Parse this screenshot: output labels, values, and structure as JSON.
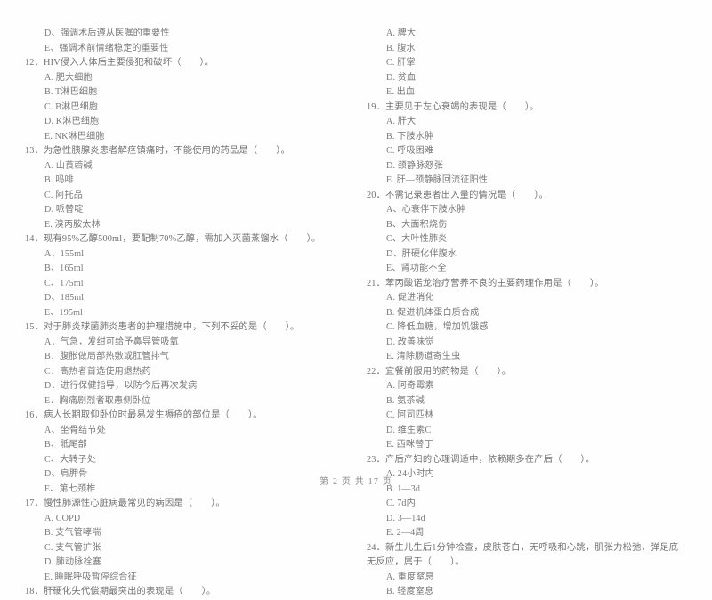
{
  "document": {
    "type": "scanned-exam-paper",
    "background_color": "#fefefe",
    "text_color": "#6e6e6e",
    "footer": "第 2 页 共 17 页"
  },
  "columns": [
    {
      "id": "left-column",
      "items": [
        {
          "kind": "option",
          "text": "D、强调术后遵从医嘱的重要性"
        },
        {
          "kind": "option",
          "text": "E、强调术前情绪稳定的重要性"
        },
        {
          "kind": "stem",
          "text": "12．HIV侵入人体后主要侵犯和破坏（　　）。"
        },
        {
          "kind": "option",
          "text": "A. 肥大细胞"
        },
        {
          "kind": "option",
          "text": "B. T淋巴细胞"
        },
        {
          "kind": "option",
          "text": "C. B淋巴细胞"
        },
        {
          "kind": "option",
          "text": "D. K淋巴细胞"
        },
        {
          "kind": "option",
          "text": "E. NK淋巴细胞"
        },
        {
          "kind": "stem",
          "text": "13．为急性胰腺炎患者解痉镇痛时，不能使用的药品是（　　）。"
        },
        {
          "kind": "option",
          "text": "A. 山莨菪碱"
        },
        {
          "kind": "option",
          "text": "B. 吗啡"
        },
        {
          "kind": "option",
          "text": "C. 阿托品"
        },
        {
          "kind": "option",
          "text": "D. 哌替啶"
        },
        {
          "kind": "option",
          "text": "E. 溴丙胺太林"
        },
        {
          "kind": "stem",
          "text": "14．现有95%乙醇500ml，要配制70%乙醇，需加入灭菌蒸馏水（　　）。"
        },
        {
          "kind": "option",
          "text": "A、155ml"
        },
        {
          "kind": "option",
          "text": "B、165ml"
        },
        {
          "kind": "option",
          "text": "C、175ml"
        },
        {
          "kind": "option",
          "text": "D、185ml"
        },
        {
          "kind": "option",
          "text": "E、195ml"
        },
        {
          "kind": "stem",
          "text": "15．对于肺炎球菌肺炎患者的护理措施中，下列不妥的是（　　）。"
        },
        {
          "kind": "option",
          "text": "A．气急，发绀可给予鼻导管吸氧"
        },
        {
          "kind": "option",
          "text": "B．腹胀做局部热敷或肛管排气"
        },
        {
          "kind": "option",
          "text": "C．高热者首选使用退热药"
        },
        {
          "kind": "option",
          "text": "D．进行保健指导，以防今后再次发病"
        },
        {
          "kind": "option",
          "text": "E．胸痛剧烈者取患侧卧位"
        },
        {
          "kind": "stem",
          "text": "16．病人长期取仰卧位时最易发生褥疮的部位是（　　）。"
        },
        {
          "kind": "option",
          "text": "A、坐骨结节处"
        },
        {
          "kind": "option",
          "text": "B、骶尾部"
        },
        {
          "kind": "option",
          "text": "C、大转子处"
        },
        {
          "kind": "option",
          "text": "D、肩胛骨"
        },
        {
          "kind": "option",
          "text": "E、第七颈椎"
        },
        {
          "kind": "stem",
          "text": "17．慢性肺源性心脏病最常见的病因是（　　）。"
        },
        {
          "kind": "option",
          "text": "A. COPD"
        },
        {
          "kind": "option",
          "text": "B. 支气管哮喘"
        },
        {
          "kind": "option",
          "text": "C. 支气管扩张"
        },
        {
          "kind": "option",
          "text": "D. 肺动脉栓塞"
        },
        {
          "kind": "option",
          "text": "E. 睡眠呼吸暂停综合征"
        },
        {
          "kind": "stem",
          "text": "18．肝硬化失代偿期最突出的表现是（　　）。"
        }
      ]
    },
    {
      "id": "right-column",
      "items": [
        {
          "kind": "option",
          "text": "A. 脾大"
        },
        {
          "kind": "option",
          "text": "B. 腹水"
        },
        {
          "kind": "option",
          "text": "C. 肝掌"
        },
        {
          "kind": "option",
          "text": "D. 贫血"
        },
        {
          "kind": "option",
          "text": "E. 出血"
        },
        {
          "kind": "stem",
          "text": "19．主要见于左心衰竭的表现是（　　）。"
        },
        {
          "kind": "option",
          "text": "A. 肝大"
        },
        {
          "kind": "option",
          "text": "B. 下肢水肿"
        },
        {
          "kind": "option",
          "text": "C. 呼吸困难"
        },
        {
          "kind": "option",
          "text": "D. 颈静脉怒张"
        },
        {
          "kind": "option",
          "text": "E. 肝—颈静脉回流征阳性"
        },
        {
          "kind": "stem",
          "text": "20．不需记录患者出入量的情况是（　　）。"
        },
        {
          "kind": "option",
          "text": "A、心衰伴下肢水肿"
        },
        {
          "kind": "option",
          "text": "B、大面积烧伤"
        },
        {
          "kind": "option",
          "text": "C、大叶性肺炎"
        },
        {
          "kind": "option",
          "text": "D、肝硬化伴腹水"
        },
        {
          "kind": "option",
          "text": "E、肾功能不全"
        },
        {
          "kind": "stem",
          "text": "21．苯丙酸诺龙治疗营养不良的主要药理作用是（　　）。"
        },
        {
          "kind": "option",
          "text": "A. 促进消化"
        },
        {
          "kind": "option",
          "text": "B. 促进机体蛋白质合成"
        },
        {
          "kind": "option",
          "text": "C. 降低血糖，增加饥饿感"
        },
        {
          "kind": "option",
          "text": "D. 改善味觉"
        },
        {
          "kind": "option",
          "text": "E. 清除肠道寄生虫"
        },
        {
          "kind": "stem",
          "text": "22．宜餐前服用的药物是（　　）。"
        },
        {
          "kind": "option",
          "text": "A. 阿奇霉素"
        },
        {
          "kind": "option",
          "text": "B. 氨茶碱"
        },
        {
          "kind": "option",
          "text": "C. 阿司匹林"
        },
        {
          "kind": "option",
          "text": "D. 维生素C"
        },
        {
          "kind": "option",
          "text": "E. 西咪替丁"
        },
        {
          "kind": "stem",
          "text": "23．产后产妇的心理调适中，依赖期多在产后（　　）。"
        },
        {
          "kind": "option",
          "text": "A. 24小时内"
        },
        {
          "kind": "option",
          "text": "B. 1—3d"
        },
        {
          "kind": "option",
          "text": "C. 7d内"
        },
        {
          "kind": "option",
          "text": "D. 3—14d"
        },
        {
          "kind": "option",
          "text": "E. 2—4周"
        },
        {
          "kind": "stem",
          "text": "24．新生儿生后1分钟检查，皮肤苍白，无呼吸和心跳，肌张力松弛，弹足底无反应，属于（　　）。"
        },
        {
          "kind": "option",
          "text": "A. 重度窒息"
        },
        {
          "kind": "option",
          "text": "B. 轻度窒息"
        }
      ]
    }
  ]
}
